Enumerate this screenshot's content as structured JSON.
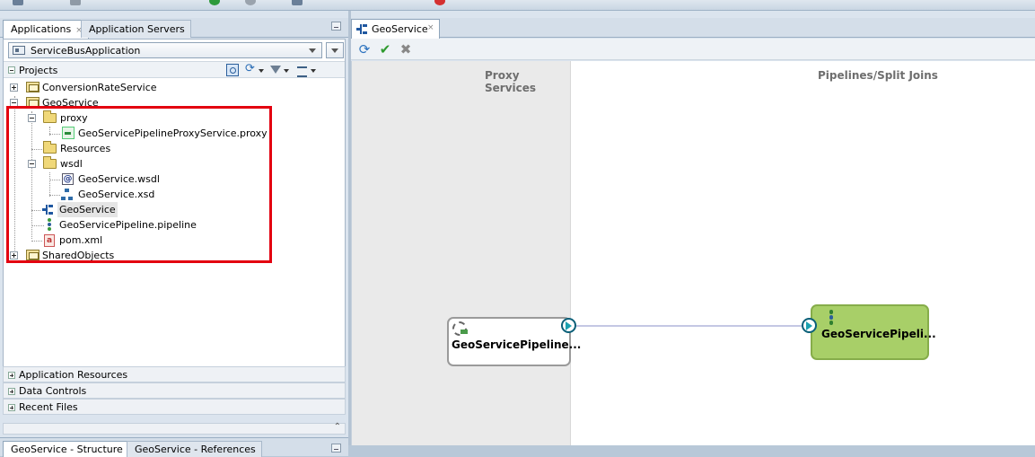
{
  "left_panel": {
    "tabs": [
      {
        "label": "Applications",
        "close": "×"
      },
      {
        "label": "Application Servers"
      }
    ],
    "app_selector": {
      "value": "ServiceBusApplication"
    },
    "projects_header": "Projects",
    "tree": {
      "conversion": "ConversionRateService",
      "geoservice": "GeoService",
      "proxy_folder": "proxy",
      "proxy_file": "GeoServicePipelineProxyService.proxy",
      "resources": "Resources",
      "wsdl_folder": "wsdl",
      "wsdl_file": "GeoService.wsdl",
      "xsd_file": "GeoService.xsd",
      "split_item": "GeoService",
      "pipeline_file": "GeoServicePipeline.pipeline",
      "pom": "pom.xml",
      "shared": "SharedObjects"
    },
    "accordions": [
      "Application Resources",
      "Data Controls",
      "Recent Files"
    ],
    "bottom_tabs": [
      {
        "label": "GeoService - Structure",
        "close": "×"
      },
      {
        "label": "GeoService - References"
      }
    ]
  },
  "editor": {
    "tab": {
      "label": "GeoService",
      "close": "×"
    },
    "lanes": {
      "proxy": "Proxy Services",
      "pipelines": "Pipelines/Split Joins"
    },
    "proxy_node": "GeoServicePipeline...",
    "pipeline_node": "GeoServicePipeli..."
  },
  "icons": {
    "folder": "folder-icon",
    "project": "project-icon",
    "proxy": "proxy-service-icon",
    "wsdl": "wsdl-icon",
    "xsd": "xsd-icon",
    "split": "split-join-icon",
    "pipeline": "pipeline-icon",
    "pom": "maven-pom-icon",
    "refresh": "refresh-icon",
    "ok": "checkmark-icon",
    "cancel": "cancel-icon"
  },
  "colors": {
    "highlight": "#e3000f",
    "pipeline_node": "#a8cf68",
    "connector_dot": "#1aa0b0"
  }
}
